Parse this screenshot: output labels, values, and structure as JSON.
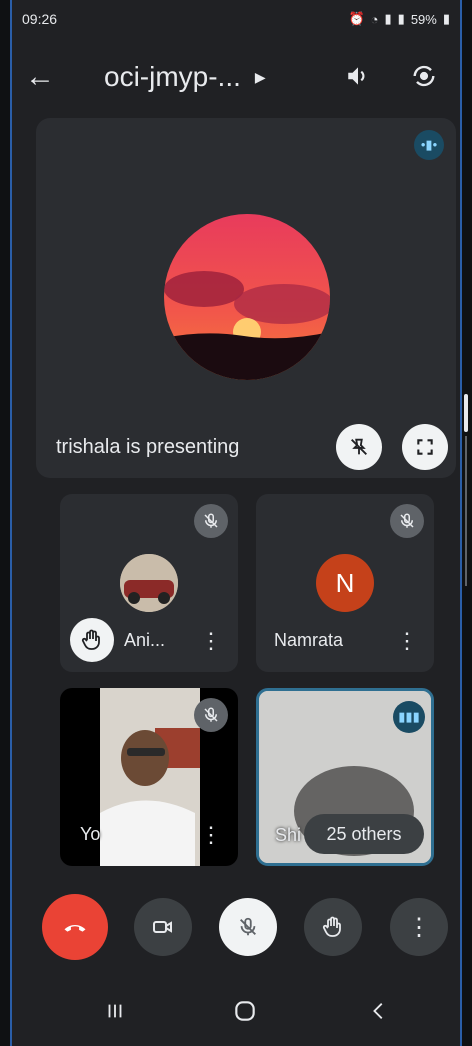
{
  "status": {
    "time": "09:26",
    "battery": "59%"
  },
  "header": {
    "meeting_code": "oci-jmyp-...",
    "icons": [
      "back-arrow-icon",
      "caret-right-icon",
      "speaker-icon",
      "switch-camera-icon"
    ]
  },
  "presenter": {
    "label": "trishala is presenting"
  },
  "participants": [
    {
      "name": "Ani...",
      "muted": true,
      "hand_raised": true
    },
    {
      "name": "Namrata",
      "initial": "N",
      "muted": true
    },
    {
      "name": "Yo",
      "muted": true
    },
    {
      "name": "Shi",
      "speaking": true
    }
  ],
  "others_label": "25 others",
  "colors": {
    "background": "#202124",
    "tile": "#2b2d31",
    "end_call": "#ea4335",
    "avatar_initial": "#c5411a",
    "speaking_highlight": "#1a4b63"
  }
}
